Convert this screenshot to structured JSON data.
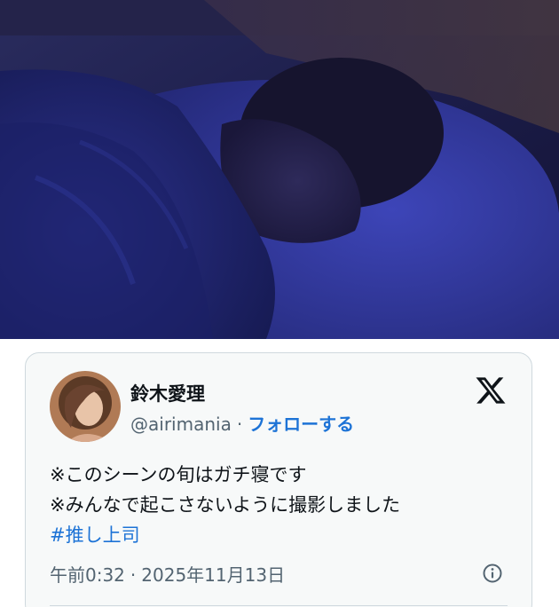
{
  "post": {
    "display_name": "鈴木愛理",
    "handle": "@airimania",
    "separator": "·",
    "follow_label": "フォローする",
    "text_lines": [
      "※このシーンの旬はガチ寝です",
      "※みんなで起こさないように撮影しました"
    ],
    "hashtag": "#推し上司",
    "time": "午前0:32",
    "date": "2025年11月13日"
  },
  "icons": {
    "platform": "x-logo-icon",
    "info": "info-icon"
  },
  "colors": {
    "link": "#1d73d6",
    "card_bg": "#f7f9f9",
    "border": "#cfd9de",
    "text": "#0f1419",
    "muted": "#536471"
  }
}
